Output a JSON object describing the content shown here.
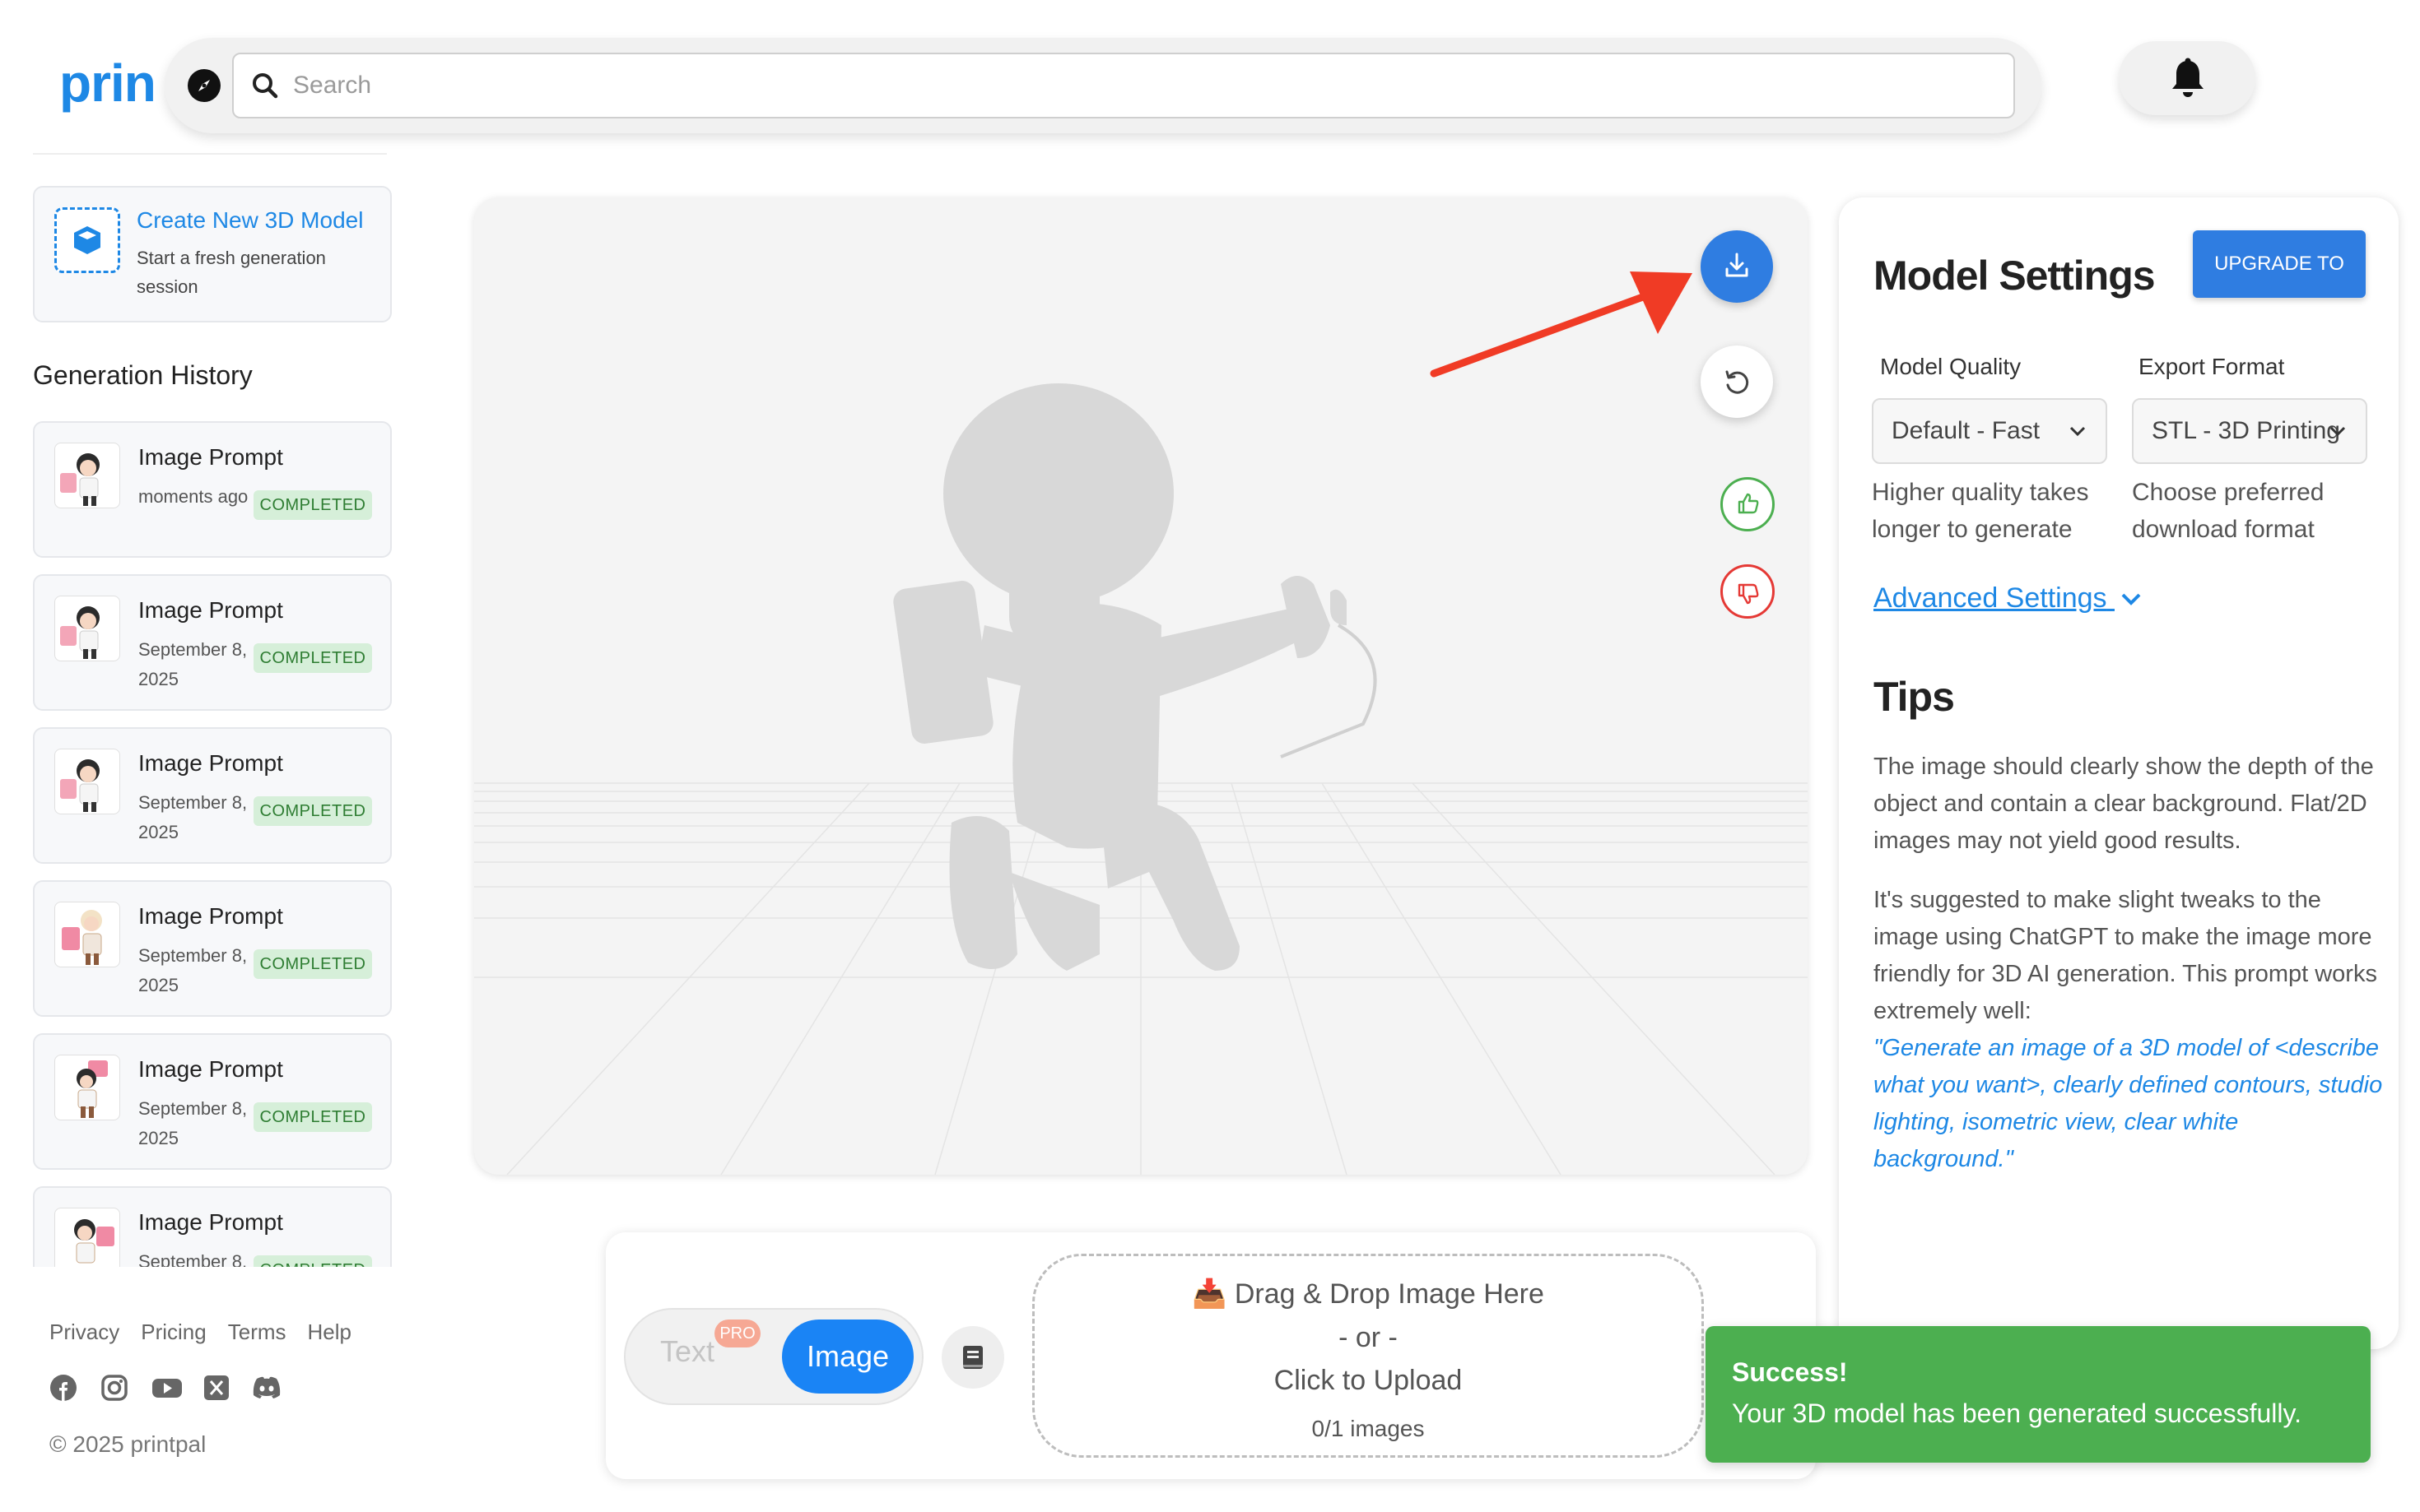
{
  "header": {
    "logo_text": "prin",
    "search_placeholder": "Search",
    "icons": [
      "compass-icon",
      "search-icon",
      "bell-icon"
    ]
  },
  "sidebar": {
    "new_model": {
      "title": "Create New 3D Model",
      "subtitle": "Start a fresh generation session"
    },
    "history_title": "Generation History",
    "history": [
      {
        "title": "Image Prompt",
        "date": "moments ago",
        "status": "COMPLETED"
      },
      {
        "title": "Image Prompt",
        "date": "September 8, 2025",
        "status": "COMPLETED"
      },
      {
        "title": "Image Prompt",
        "date": "September 8, 2025",
        "status": "COMPLETED"
      },
      {
        "title": "Image Prompt",
        "date": "September 8, 2025",
        "status": "COMPLETED"
      },
      {
        "title": "Image Prompt",
        "date": "September 8, 2025",
        "status": "COMPLETED"
      },
      {
        "title": "Image Prompt",
        "date": "September 8,",
        "status": "COMPLETED"
      }
    ],
    "footer_links": [
      "Privacy",
      "Pricing",
      "Terms",
      "Help"
    ],
    "social_icons": [
      "facebook-icon",
      "instagram-icon",
      "youtube-icon",
      "x-icon",
      "discord-icon"
    ],
    "copyright": "© 2025 printpal"
  },
  "viewer": {
    "buttons": [
      "download-icon",
      "reset-view-icon",
      "thumbs-up-icon",
      "thumbs-down-icon"
    ],
    "model_color": "#d8d8d8"
  },
  "input_panel": {
    "text_mode": "Text",
    "pro_badge": "PRO",
    "image_mode": "Image",
    "dropzone": {
      "line1": "📥 Drag & Drop Image Here",
      "line2": "- or -",
      "line3": "Click to Upload",
      "count": "0/1 images"
    }
  },
  "settings": {
    "title": "Model Settings",
    "upgrade_label": "UPGRADE TO PRO",
    "quality": {
      "label": "Model Quality",
      "value": "Default - Fast",
      "help": "Higher quality takes longer to generate"
    },
    "format": {
      "label": "Export Format",
      "value": "STL - 3D Printing",
      "help": "Choose preferred download format"
    },
    "advanced_label": "Advanced Settings",
    "tips_title": "Tips",
    "tip1": "The image should clearly show the depth of the object and contain a clear background. Flat/2D images may not yield good results.",
    "tip2": "It's suggested to make slight tweaks to the image using ChatGPT to make the image more friendly for 3D AI generation. This prompt works extremely well:",
    "tip_quote": "\"Generate an image of a 3D model of <describe what you want>, clearly defined contours, studio lighting, isometric view, clear white background.\""
  },
  "toast": {
    "title": "Success!",
    "message": "Your 3D model has been generated successfully."
  },
  "colors": {
    "brand": "#1e88e5",
    "primary_button": "#2f7de1",
    "success": "#4caf50",
    "danger": "#e53935",
    "annotation_arrow": "#f03b25"
  }
}
